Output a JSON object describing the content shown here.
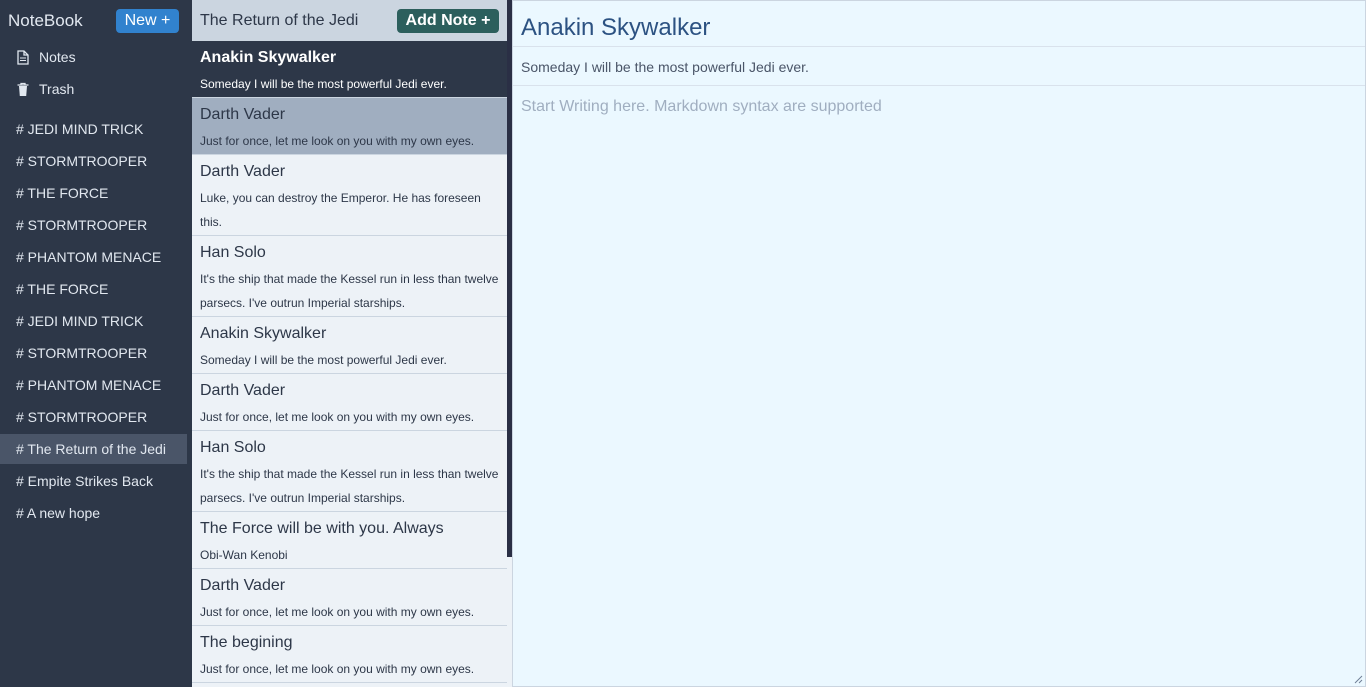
{
  "sidebar": {
    "brand": "NoteBook",
    "new_button": "New +",
    "nav": [
      {
        "label": "Notes",
        "icon": "document-icon"
      },
      {
        "label": "Trash",
        "icon": "trash-icon"
      }
    ],
    "tags": [
      "# JEDI MIND TRICK",
      "# STORMTROOPER",
      "# THE FORCE",
      "# STORMTROOPER",
      "# PHANTOM MENACE",
      "# THE FORCE",
      "# JEDI MIND TRICK",
      "# STORMTROOPER",
      "# PHANTOM MENACE",
      "# STORMTROOPER",
      "# The Return of the Jedi",
      "# Empite Strikes Back",
      "# A new hope"
    ],
    "active_tag": "# The Return of the Jedi"
  },
  "list": {
    "title": "The Return of the Jedi",
    "add_button": "Add Note +",
    "notes": [
      {
        "title": "Anakin Skywalker",
        "body": "Someday I will be the most powerful Jedi ever."
      },
      {
        "title": "Darth Vader",
        "body": "Just for once, let me look on you with my own eyes."
      },
      {
        "title": "Darth Vader",
        "body": "Luke, you can destroy the Emperor. He has foreseen this."
      },
      {
        "title": "Han Solo",
        "body": "It's the ship that made the Kessel run in less than twelve parsecs. I've outrun Imperial starships."
      },
      {
        "title": "Anakin Skywalker",
        "body": "Someday I will be the most powerful Jedi ever."
      },
      {
        "title": "Darth Vader",
        "body": "Just for once, let me look on you with my own eyes."
      },
      {
        "title": "Han Solo",
        "body": "It's the ship that made the Kessel run in less than twelve parsecs. I've outrun Imperial starships."
      },
      {
        "title": "The Force will be with you. Always",
        "body": "Obi-Wan Kenobi"
      },
      {
        "title": "Darth Vader",
        "body": "Just for once, let me look on you with my own eyes."
      },
      {
        "title": "The begining",
        "body": "Just for once, let me look on you with my own eyes."
      }
    ]
  },
  "editor": {
    "title": "Anakin Skywalker",
    "description": "Someday I will be the most powerful Jedi ever.",
    "body_placeholder": "Start Writing here. Markdown syntax are supported"
  },
  "colors": {
    "sidebar_bg": "#2d3748",
    "accent_blue": "#3182ce",
    "add_button_bg": "#2c5f5d",
    "editor_bg": "#ebf8ff",
    "title_blue": "#2c5282"
  }
}
